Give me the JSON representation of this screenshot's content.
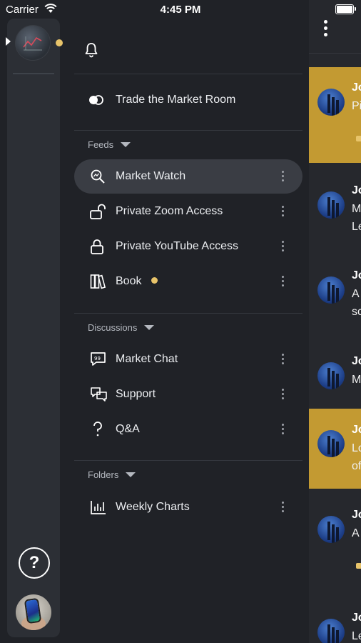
{
  "status_bar": {
    "carrier": "Carrier",
    "time": "4:45 PM"
  },
  "colors": {
    "accent": "#e8c46a",
    "highlight_row": "#c39a32",
    "panel_bg": "#202227",
    "rail_bg": "#2c2f35"
  },
  "room": {
    "label": "Trade the Market Room",
    "icon": "toggle-icon"
  },
  "sections": {
    "feeds": {
      "title": "Feeds",
      "items": [
        {
          "label": "Market Watch",
          "icon": "search-chart-icon",
          "active": true
        },
        {
          "label": "Private Zoom Access",
          "icon": "unlock-icon"
        },
        {
          "label": "Private YouTube Access",
          "icon": "lock-icon"
        },
        {
          "label": "Book",
          "icon": "books-icon",
          "unread": true
        }
      ]
    },
    "discussions": {
      "title": "Discussions",
      "items": [
        {
          "label": "Market Chat",
          "icon": "chat-bubble-icon"
        },
        {
          "label": "Support",
          "icon": "support-chat-icon"
        },
        {
          "label": "Q&A",
          "icon": "question-icon"
        }
      ]
    },
    "folders": {
      "title": "Folders",
      "items": [
        {
          "label": "Weekly Charts",
          "icon": "bar-chart-icon"
        }
      ]
    }
  },
  "messages": [
    {
      "name": "Jo",
      "lines": [
        "Pi"
      ],
      "highlighted": true
    },
    {
      "name": "Jo",
      "lines": [
        "M",
        "Le"
      ]
    },
    {
      "name": "Jo",
      "lines": [
        "A",
        "sc"
      ]
    },
    {
      "name": "Jo",
      "lines": [
        "M"
      ]
    },
    {
      "name": "Jo",
      "lines": [
        "Lo",
        "of"
      ],
      "highlighted": true
    },
    {
      "name": "Jo",
      "lines": [
        "A"
      ]
    },
    {
      "name": "Jo",
      "lines": [
        "Le"
      ]
    }
  ]
}
